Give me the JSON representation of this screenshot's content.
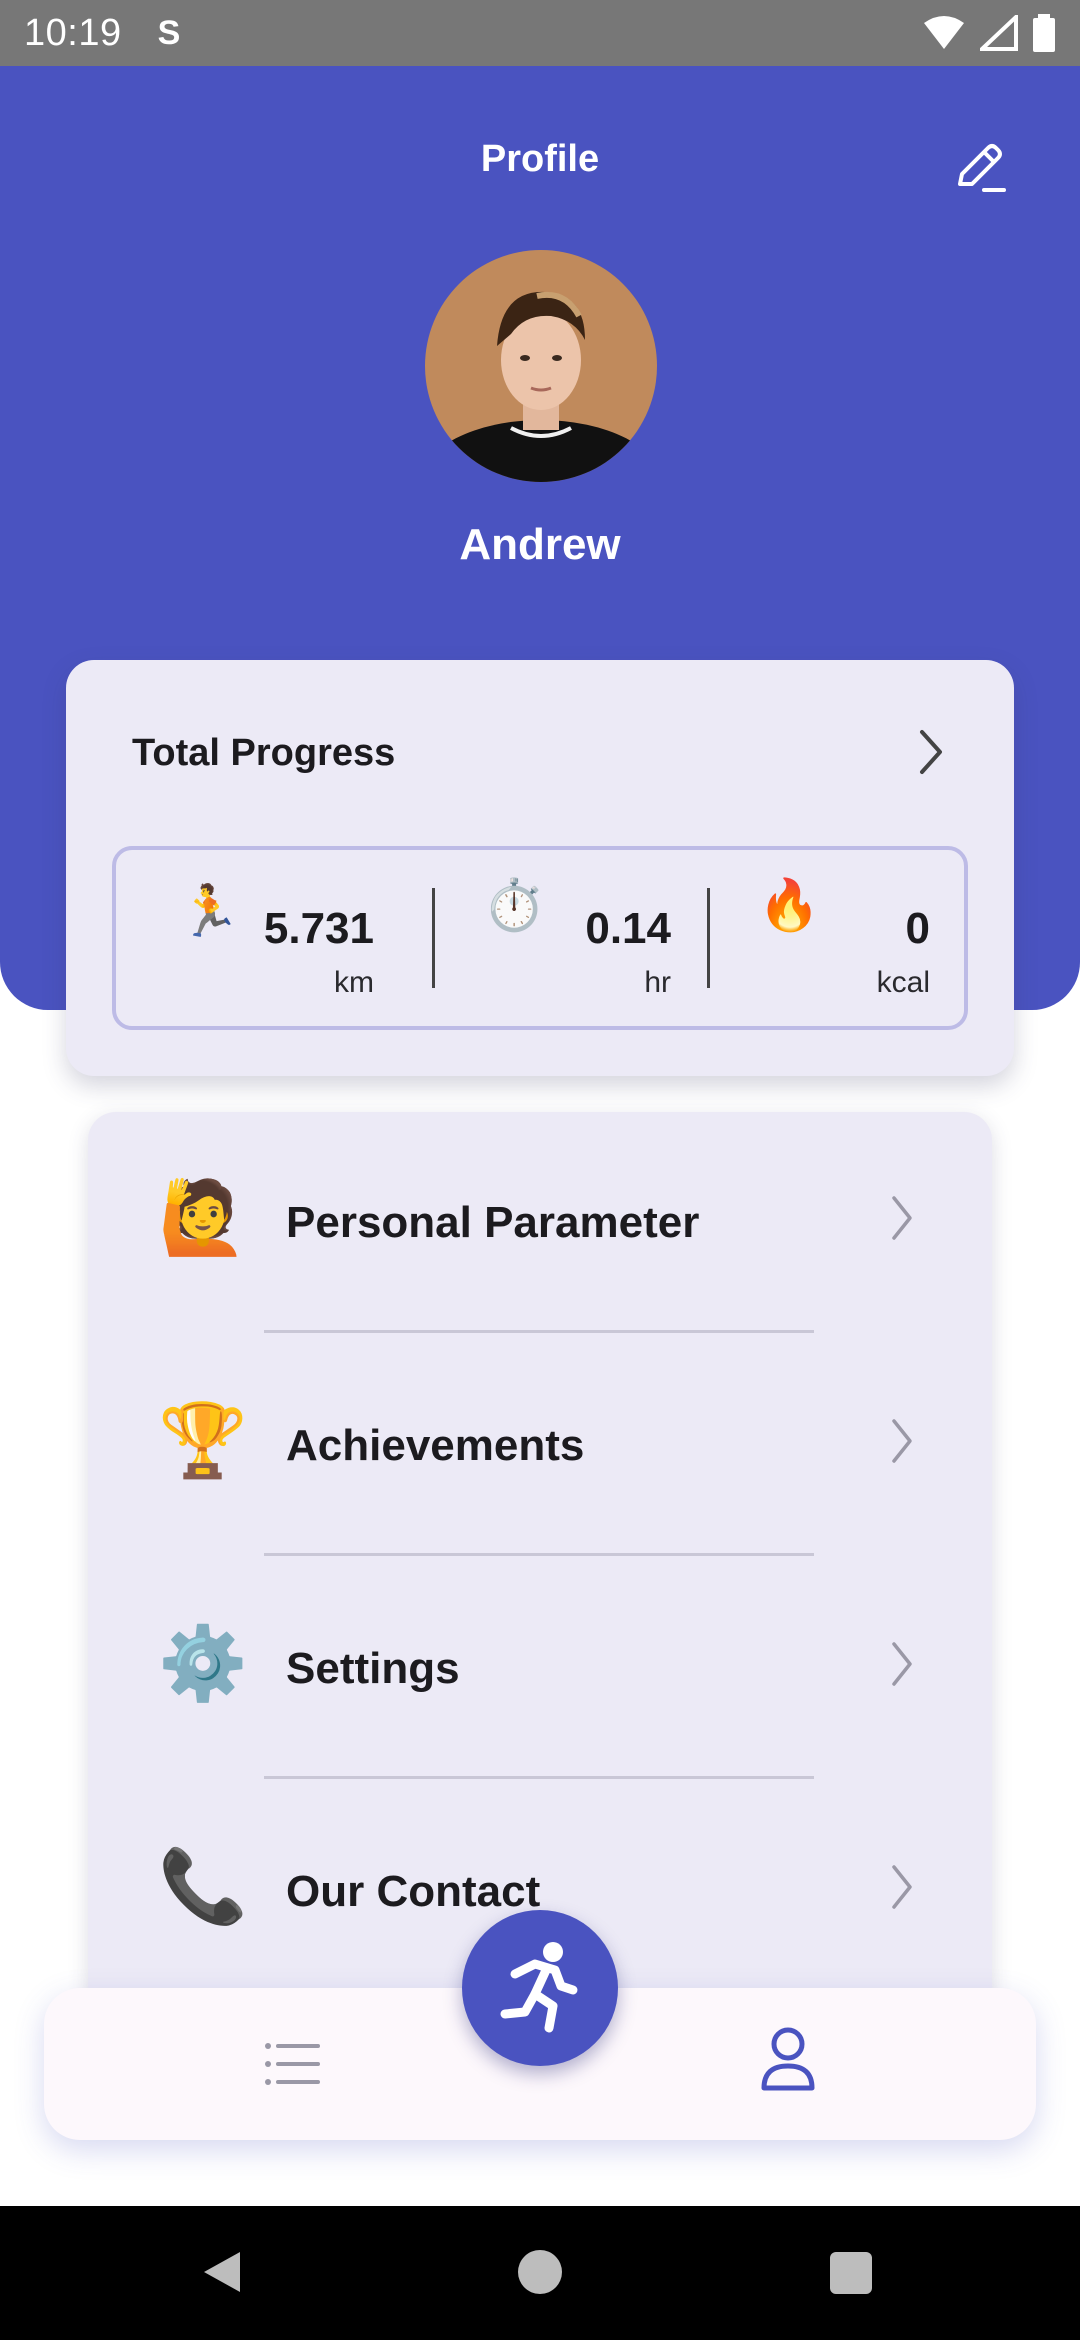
{
  "status_bar": {
    "time": "10:19",
    "indicator": "S"
  },
  "header": {
    "title": "Profile",
    "user_name": "Andrew",
    "color": "#4a53c0"
  },
  "progress": {
    "title": "Total Progress",
    "stats": [
      {
        "icon": "🏃",
        "icon_name": "runner-icon",
        "value": "5.731",
        "unit": "km"
      },
      {
        "icon": "⏱️",
        "icon_name": "stopwatch-icon",
        "value": "0.14",
        "unit": "hr"
      },
      {
        "icon": "🔥",
        "icon_name": "fire-icon",
        "value": "0",
        "unit": "kcal"
      }
    ]
  },
  "menu": {
    "items": [
      {
        "icon": "🙋",
        "icon_name": "person-raising-hand-icon",
        "label": "Personal Parameter"
      },
      {
        "icon": "🏆",
        "icon_name": "trophy-icon",
        "label": "Achievements"
      },
      {
        "icon": "⚙️",
        "icon_name": "gear-icon",
        "label": "Settings"
      },
      {
        "icon": "📞",
        "icon_name": "phone-icon",
        "label": "Our Contact"
      }
    ]
  },
  "bottom_nav": {
    "items": [
      "list-icon",
      "running-fab-icon",
      "profile-icon"
    ],
    "active": "profile-icon"
  }
}
